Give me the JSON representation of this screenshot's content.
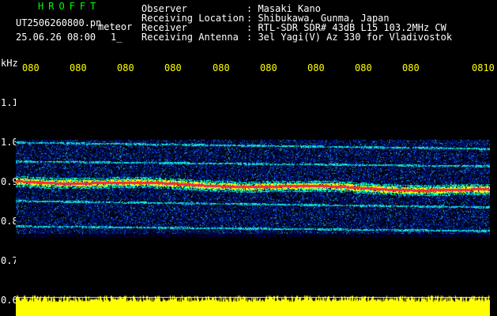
{
  "header": {
    "station": "HROFFT",
    "filename": "UT2506260800.pn",
    "tag": "meteor",
    "datetime": "25.06.26 08:00",
    "sub": "1_",
    "observer_label": "Observer",
    "observer_value": ": Masaki Kano",
    "location_label": "Receiving Location",
    "location_value": ": Shibukawa, Gunma, Japan",
    "receiver_label": "Receiver",
    "receiver_value": ": RTL-SDR SDR# 43dB L15 103.2MHz CW",
    "antenna_label": "Receiving Antenna",
    "antenna_value": ": 3el Yagi(V) Az 330 for Vladivostok"
  },
  "axis": {
    "unit": "kHz",
    "y_ticks": [
      "1.1",
      "1.0",
      "0.9",
      "0.8",
      "0.7",
      "0.6"
    ],
    "time_ticks": [
      "080",
      "080",
      "080",
      "080",
      "080",
      "080",
      "080",
      "080",
      "080",
      "0810"
    ]
  },
  "colors": {
    "background": "#000000",
    "text": "#ffffff",
    "accent_yellow": "#ffff00",
    "station_green": "#00ff00",
    "signal_red": "#ff2020",
    "noise_blue": "#0030c0"
  }
}
